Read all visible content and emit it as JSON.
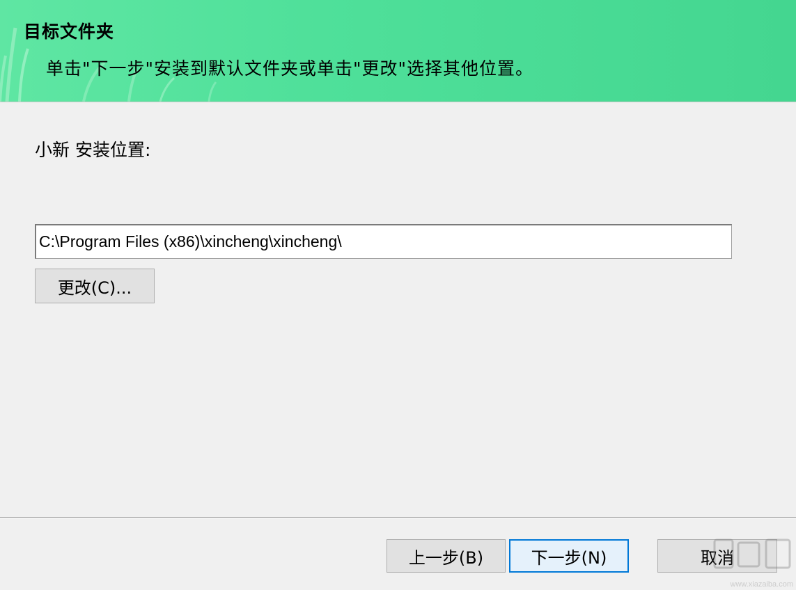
{
  "header": {
    "title": "目标文件夹",
    "subtitle": "单击\"下一步\"安装到默认文件夹或单击\"更改\"选择其他位置。"
  },
  "main": {
    "location_label": "小新 安装位置:",
    "install_path": "C:\\Program Files (x86)\\xincheng\\xincheng\\",
    "change_button": "更改(C)..."
  },
  "footer": {
    "back_button": "上一步(B)",
    "next_button": "下一步(N)",
    "cancel_button": "取消"
  },
  "watermark": {
    "url": "www.xiazaiba.com"
  },
  "colors": {
    "header_bg": "#4fe09a",
    "window_bg": "#f0f0f0",
    "default_button_border": "#0078d7"
  }
}
